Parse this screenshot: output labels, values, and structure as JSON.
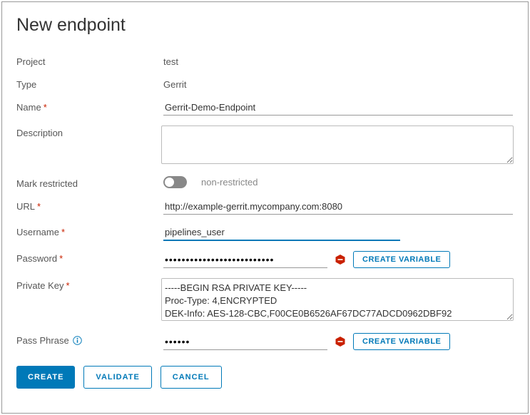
{
  "title": "New endpoint",
  "labels": {
    "project": "Project",
    "type": "Type",
    "name": "Name",
    "description": "Description",
    "markRestricted": "Mark restricted",
    "url": "URL",
    "username": "Username",
    "password": "Password",
    "privateKey": "Private Key",
    "passPhrase": "Pass Phrase"
  },
  "values": {
    "project": "test",
    "type": "Gerrit",
    "name": "Gerrit-Demo-Endpoint",
    "description": "",
    "restrictedLabel": "non-restricted",
    "url": "http://example-gerrit.mycompany.com:8080",
    "username": "pipelines_user",
    "password": "••••••••••••••••••••••••••",
    "privateKey": "-----BEGIN RSA PRIVATE KEY-----\nProc-Type: 4,ENCRYPTED\nDEK-Info: AES-128-CBC,F00CE0B6526AF67DC77ADCD0962DBF92",
    "passPhrase": "••••••"
  },
  "buttons": {
    "createVariable": "CREATE VARIABLE",
    "create": "CREATE",
    "validate": "VALIDATE",
    "cancel": "CANCEL"
  }
}
